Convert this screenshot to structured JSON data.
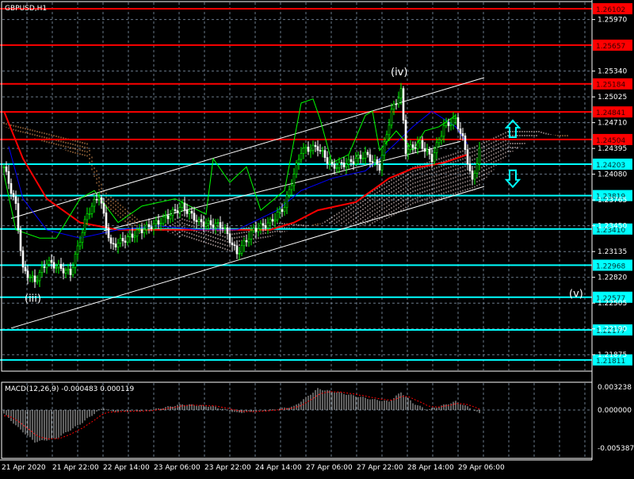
{
  "title": "GBPUSD,H1",
  "colors": {
    "bg": "#000000",
    "bull": "#00ff00",
    "bear": "#ffffff",
    "red": "#ff0000",
    "cyan": "#00ffff",
    "blue": "#0000ff",
    "cloud_up": "#f4a460",
    "cloud_down": "#ffe4e1"
  },
  "chart_data": {
    "type": "line",
    "symbol": "GBPUSD,H1",
    "ylim": [
      1.2163,
      1.26215
    ],
    "y_ticks": [
      "1.25970",
      "1.25340",
      "1.25025",
      "1.24710",
      "1.24395",
      "1.24080",
      "1.23765",
      "1.23450",
      "1.23135",
      "1.22820",
      "1.22505",
      "1.22190",
      "1.21875"
    ],
    "levels": [
      {
        "price": "1.26102",
        "color": "red"
      },
      {
        "price": "1.25657",
        "color": "red"
      },
      {
        "price": "1.25184",
        "color": "red"
      },
      {
        "price": "1.24841",
        "color": "red"
      },
      {
        "price": "1.24504",
        "color": "red"
      },
      {
        "price": "1.24203",
        "color": "cyan"
      },
      {
        "price": "1.23819",
        "color": "cyan"
      },
      {
        "price": "1.23410",
        "color": "cyan"
      },
      {
        "price": "1.22968",
        "color": "cyan"
      },
      {
        "price": "1.22577",
        "color": "cyan"
      },
      {
        "price": "1.22177",
        "color": "cyan"
      },
      {
        "price": "1.21811",
        "color": "cyan"
      }
    ],
    "x_labels": [
      "21 Apr 2020",
      "21 Apr 22:00",
      "22 Apr 14:00",
      "23 Apr 06:00",
      "23 Apr 22:00",
      "24 Apr 14:00",
      "27 Apr 06:00",
      "27 Apr 22:00",
      "28 Apr 14:00",
      "29 Apr 06:00"
    ],
    "close_waypoints": [
      [
        0,
        1.2417
      ],
      [
        5,
        1.2369
      ],
      [
        8,
        1.2291
      ],
      [
        13,
        1.2277
      ],
      [
        18,
        1.2301
      ],
      [
        28,
        1.2287
      ],
      [
        35,
        1.2359
      ],
      [
        40,
        1.2383
      ],
      [
        45,
        1.232
      ],
      [
        52,
        1.233
      ],
      [
        58,
        1.234
      ],
      [
        65,
        1.2349
      ],
      [
        75,
        1.2369
      ],
      [
        82,
        1.2349
      ],
      [
        92,
        1.2345
      ],
      [
        98,
        1.2311
      ],
      [
        105,
        1.234
      ],
      [
        112,
        1.2349
      ],
      [
        118,
        1.2369
      ],
      [
        125,
        1.2437
      ],
      [
        132,
        1.2441
      ],
      [
        138,
        1.2417
      ],
      [
        145,
        1.2422
      ],
      [
        152,
        1.2432
      ],
      [
        158,
        1.2417
      ],
      [
        163,
        1.2485
      ],
      [
        167,
        1.2509
      ],
      [
        169,
        1.2437
      ],
      [
        175,
        1.2446
      ],
      [
        180,
        1.2427
      ],
      [
        185,
        1.2466
      ],
      [
        190,
        1.2475
      ],
      [
        193,
        1.2451
      ],
      [
        197,
        1.2398
      ],
      [
        200,
        1.2437
      ]
    ],
    "ma_red": [
      [
        0,
        1.2485
      ],
      [
        8,
        1.2427
      ],
      [
        18,
        1.2378
      ],
      [
        32,
        1.2349
      ],
      [
        48,
        1.234
      ],
      [
        65,
        1.234
      ],
      [
        92,
        1.234
      ],
      [
        112,
        1.234
      ],
      [
        122,
        1.2349
      ],
      [
        132,
        1.2364
      ],
      [
        148,
        1.2374
      ],
      [
        162,
        1.2403
      ],
      [
        172,
        1.2415
      ],
      [
        185,
        1.2422
      ],
      [
        195,
        1.2432
      ]
    ],
    "ma_blue": [
      [
        2,
        1.2442
      ],
      [
        8,
        1.2378
      ],
      [
        18,
        1.234
      ],
      [
        32,
        1.233
      ],
      [
        48,
        1.234
      ],
      [
        65,
        1.2345
      ],
      [
        82,
        1.234
      ],
      [
        98,
        1.234
      ],
      [
        115,
        1.2364
      ],
      [
        125,
        1.2388
      ],
      [
        138,
        1.2403
      ],
      [
        152,
        1.2412
      ],
      [
        158,
        1.2427
      ],
      [
        172,
        1.2466
      ],
      [
        180,
        1.2485
      ],
      [
        190,
        1.2466
      ],
      [
        195,
        1.2445
      ]
    ],
    "chikou_green": [
      [
        0,
        1.2408
      ],
      [
        5,
        1.234
      ],
      [
        15,
        1.233
      ],
      [
        22,
        1.233
      ],
      [
        32,
        1.2378
      ],
      [
        38,
        1.2388
      ],
      [
        48,
        1.2349
      ],
      [
        58,
        1.2369
      ],
      [
        72,
        1.2378
      ],
      [
        85,
        1.2359
      ],
      [
        88,
        1.2427
      ],
      [
        95,
        1.2398
      ],
      [
        102,
        1.2417
      ],
      [
        108,
        1.2364
      ],
      [
        118,
        1.2388
      ],
      [
        125,
        1.2495
      ],
      [
        130,
        1.25
      ],
      [
        133,
        1.2475
      ],
      [
        138,
        1.2422
      ],
      [
        145,
        1.2432
      ],
      [
        152,
        1.248
      ],
      [
        155,
        1.2485
      ],
      [
        158,
        1.2437
      ],
      [
        165,
        1.2461
      ],
      [
        172,
        1.2437
      ],
      [
        177,
        1.2461
      ],
      [
        183,
        1.2466
      ],
      [
        190,
        1.248
      ]
    ],
    "cloud_span_a": [
      [
        0,
        1.2466
      ],
      [
        35,
        1.2427
      ],
      [
        42,
        1.2369
      ],
      [
        58,
        1.233
      ],
      [
        75,
        1.2359
      ],
      [
        95,
        1.234
      ],
      [
        115,
        1.2349
      ],
      [
        132,
        1.2345
      ],
      [
        155,
        1.2388
      ],
      [
        172,
        1.2417
      ],
      [
        198,
        1.2442
      ],
      [
        212,
        1.2461
      ],
      [
        225,
        1.2461
      ],
      [
        237,
        1.2451
      ]
    ],
    "cloud_span_b": [
      [
        0,
        1.2471
      ],
      [
        35,
        1.2446
      ],
      [
        42,
        1.2388
      ],
      [
        58,
        1.2349
      ],
      [
        75,
        1.233
      ],
      [
        95,
        1.2311
      ],
      [
        115,
        1.2335
      ],
      [
        132,
        1.2348
      ],
      [
        155,
        1.2345
      ],
      [
        172,
        1.2369
      ],
      [
        198,
        1.2388
      ],
      [
        212,
        1.2432
      ],
      [
        225,
        1.2456
      ],
      [
        237,
        1.2456
      ]
    ],
    "channel_lines": [
      {
        "from": [
          3,
          1.2354
        ],
        "to": [
          202,
          1.2526
        ]
      },
      {
        "from": [
          42,
          1.2339
        ],
        "to": [
          192,
          1.2448
        ]
      },
      {
        "from": [
          3,
          1.222
        ],
        "to": [
          202,
          1.2393
        ]
      }
    ],
    "wave_labels": [
      {
        "text": "(iv)",
        "bar": 166,
        "price": 1.2529
      },
      {
        "text": "(iii)",
        "bar": 12,
        "price": 1.2252
      },
      {
        "text": "(v)",
        "bar": 241,
        "price": 1.2258
      }
    ],
    "arrows": [
      {
        "dir": "up",
        "bar": 214,
        "price": 1.2462
      },
      {
        "dir": "down",
        "bar": 214,
        "price": 1.2404
      }
    ],
    "macd": {
      "label": "MACD(12,26,9) -0.000483 0.000119",
      "ylim": [
        -0.005387,
        0.003238
      ],
      "y_ticks": [
        "0.003238",
        "0.000000",
        "-0.005387"
      ],
      "hist_waypoints": [
        [
          0,
          -0.0005
        ],
        [
          6,
          -0.0025
        ],
        [
          13,
          -0.0045
        ],
        [
          22,
          -0.004
        ],
        [
          32,
          -0.002
        ],
        [
          40,
          0.0
        ],
        [
          42,
          0.0003
        ],
        [
          45,
          -0.0002
        ],
        [
          60,
          -0.0001
        ],
        [
          75,
          0.0008
        ],
        [
          88,
          0.0005
        ],
        [
          98,
          -0.0004
        ],
        [
          112,
          0.0
        ],
        [
          122,
          0.0005
        ],
        [
          132,
          0.003
        ],
        [
          140,
          0.0025
        ],
        [
          155,
          0.0015
        ],
        [
          162,
          0.0012
        ],
        [
          167,
          0.0025
        ],
        [
          172,
          0.001
        ],
        [
          178,
          0.0
        ],
        [
          190,
          0.0012
        ],
        [
          196,
          0.0003
        ],
        [
          200,
          -0.0005
        ]
      ]
    }
  }
}
